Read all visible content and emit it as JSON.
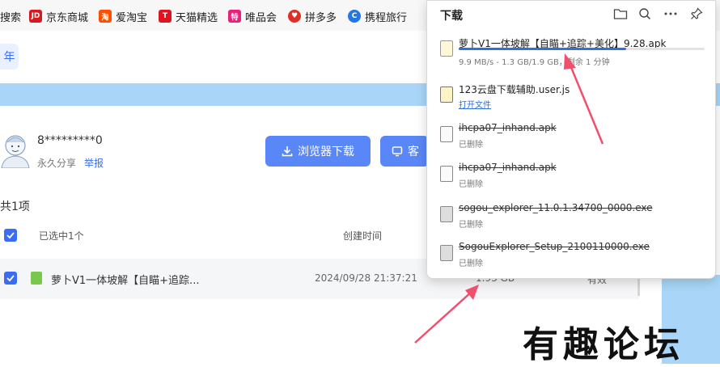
{
  "bookmarks": [
    {
      "label": "搜索"
    },
    {
      "label": "京东商城",
      "icon": "jd-icon"
    },
    {
      "label": "爱淘宝",
      "icon": "taobao-icon"
    },
    {
      "label": "天猫精选",
      "icon": "tmall-icon"
    },
    {
      "label": "唯品会",
      "icon": "vip-icon"
    },
    {
      "label": "拼多多",
      "icon": "pinduoduo-icon"
    },
    {
      "label": "携程旅行",
      "icon": "ctrip-icon"
    }
  ],
  "page": {
    "pill_label": "年",
    "sharer": "8*********0",
    "share_type": "永久分享",
    "report": "举报",
    "browser_download": "浏览器下载",
    "client_download": "客",
    "count": "共1项",
    "selected": "已选中1个",
    "created_header": "创建时间",
    "file": {
      "name": "萝卜V1一体坡解【自瞄+追踪...",
      "date": "2024/09/28 21:37:21",
      "size": "1.93 GB",
      "state": "有效"
    }
  },
  "download_panel": {
    "title": "下载",
    "items": [
      {
        "name": "萝卜V1一体坡解【自瞄+追踪+美化】9.28.apk",
        "status": "9.9 MB/s - 1.3 GB/1.9 GB，剩余 1 分钟",
        "progress": 0.68,
        "state": "downloading"
      },
      {
        "name": "123云盘下载辅助.user.js",
        "status": "打开文件",
        "state": "done"
      },
      {
        "name": "ihcpa07_inhand.apk",
        "status": "已删除",
        "state": "deleted"
      },
      {
        "name": "ihcpa07_inhand.apk",
        "status": "已删除",
        "state": "deleted"
      },
      {
        "name": "sogou_explorer_11.0.1.34700_0000.exe",
        "status": "已删除",
        "state": "deleted"
      },
      {
        "name": "SogouExplorer_Setup_2100110000.exe",
        "status": "已删除",
        "state": "deleted"
      }
    ]
  },
  "watermark": "有趣论坛",
  "colors": {
    "accent": "#5a87f7",
    "banner": "#a9d6f8",
    "progress": "#2f6fe0",
    "arrow": "#f0506e"
  }
}
